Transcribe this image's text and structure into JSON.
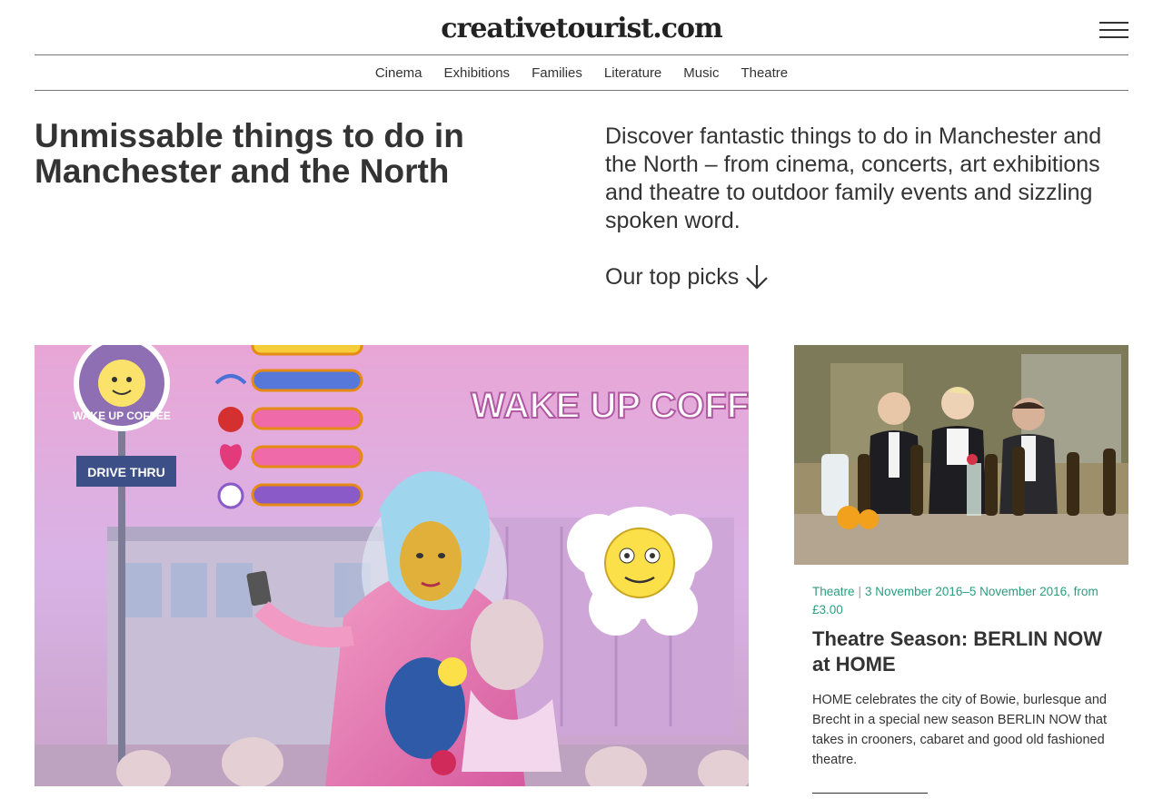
{
  "site": {
    "logo": "creativetourist.com"
  },
  "nav": {
    "items": [
      "Cinema",
      "Exhibitions",
      "Families",
      "Literature",
      "Music",
      "Theatre"
    ]
  },
  "hero": {
    "title": "Unmissable things to do in Manchester and the North",
    "intro": "Discover fantastic things to do in Manchester and the North – from cinema, concerts, art exhibitions and theatre to outdoor family events and sizzling spoken word.",
    "top_picks": "Our top picks"
  },
  "feature": {
    "image_texts": {
      "sign": "WAKE UP COFFEE",
      "badge": "WAKE UP COFFEE",
      "street_sign": "DRIVE THRU"
    }
  },
  "card": {
    "category": "Theatre",
    "dates": "3 November 2016–5 November 2016, from £3.00",
    "title": "Theatre Season: BERLIN NOW at HOME",
    "description": "HOME celebrates the city of Bowie, burlesque and Brecht in a special new season BERLIN NOW that takes in crooners, cabaret and good old fashioned theatre."
  },
  "colors": {
    "accent": "#2a9d7f",
    "text": "#333333"
  }
}
